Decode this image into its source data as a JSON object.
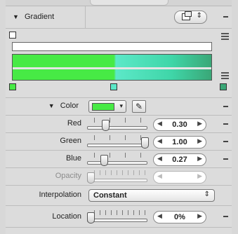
{
  "header": {
    "ghost_text": "Gradient"
  },
  "gradient": {
    "title": "Gradient",
    "disclosure": "▼",
    "popup_arrows": "⇕",
    "colors": {
      "left": "#47ea45",
      "middle": "#5ce8c8",
      "right": "#3aa777"
    }
  },
  "color_row": {
    "disclosure": "▼",
    "label": "Color",
    "swatch": "#47ea45",
    "arrow": "▾",
    "dropper": "✎"
  },
  "params": [
    {
      "label": "Red",
      "value": "0.30"
    },
    {
      "label": "Green",
      "value": "1.00"
    },
    {
      "label": "Blue",
      "value": "0.27"
    },
    {
      "label": "Opacity",
      "value": ""
    }
  ],
  "interpolation": {
    "label": "Interpolation",
    "value": "Constant",
    "arrows": "⇕"
  },
  "location": {
    "label": "Location",
    "value": "0%"
  },
  "stepper_arrows": {
    "left": "◀",
    "right": "▶"
  }
}
